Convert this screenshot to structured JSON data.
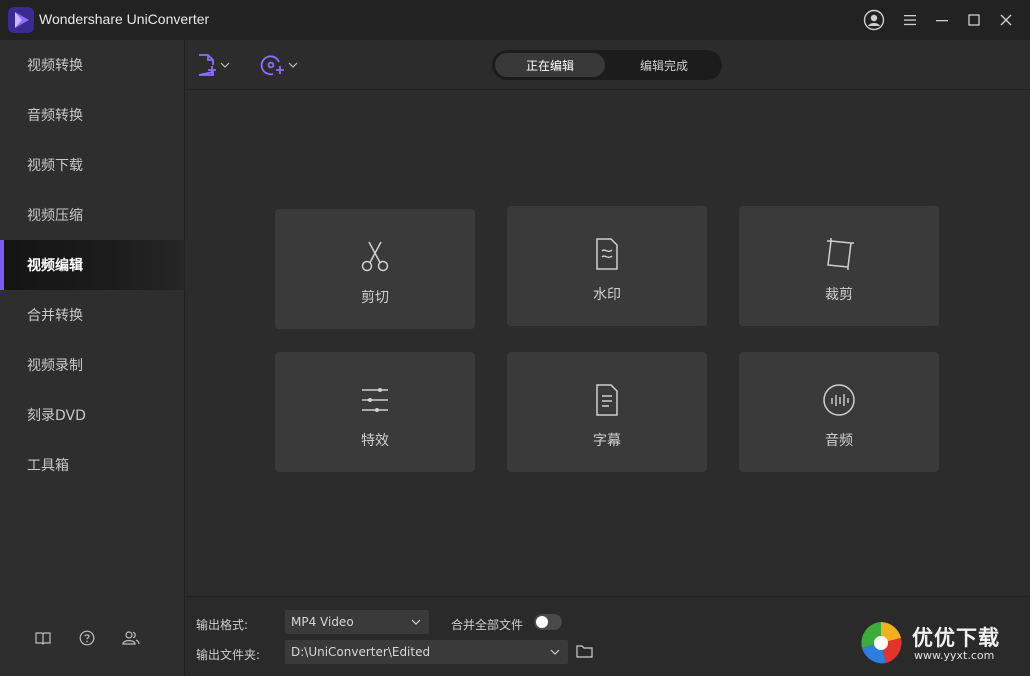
{
  "app": {
    "title": "Wondershare UniConverter"
  },
  "sidebar": {
    "items": [
      {
        "label": "视频转换"
      },
      {
        "label": "音频转换"
      },
      {
        "label": "视频下载"
      },
      {
        "label": "视频压缩"
      },
      {
        "label": "视频编辑",
        "active": true
      },
      {
        "label": "合并转换"
      },
      {
        "label": "视频录制"
      },
      {
        "label": "刻录DVD"
      },
      {
        "label": "工具箱"
      }
    ],
    "bottom_icons": [
      "book-icon",
      "help-icon",
      "users-icon"
    ]
  },
  "toolbar": {
    "add_file_icon": "add-file-icon",
    "add_dvd_icon": "add-dvd-icon",
    "tabs": [
      {
        "label": "正在编辑",
        "active": true
      },
      {
        "label": "编辑完成"
      }
    ]
  },
  "tools": [
    {
      "label": "剪切",
      "icon": "scissors-icon"
    },
    {
      "label": "水印",
      "icon": "watermark-icon"
    },
    {
      "label": "裁剪",
      "icon": "crop-icon"
    },
    {
      "label": "特效",
      "icon": "effects-icon"
    },
    {
      "label": "字幕",
      "icon": "subtitle-icon"
    },
    {
      "label": "音频",
      "icon": "audio-icon"
    }
  ],
  "bottom": {
    "format_label": "输出格式:",
    "format_value": "MP4 Video",
    "merge_label": "合并全部文件",
    "merge_enabled": false,
    "folder_label": "输出文件夹:",
    "folder_value": "D:\\UniConverter\\Edited"
  },
  "watermark": {
    "name": "优优下载",
    "url": "www.yyxt.com"
  },
  "colors": {
    "accent": "#7a5cf5",
    "background": "#2b2b2b",
    "card": "#3a3a3a"
  }
}
